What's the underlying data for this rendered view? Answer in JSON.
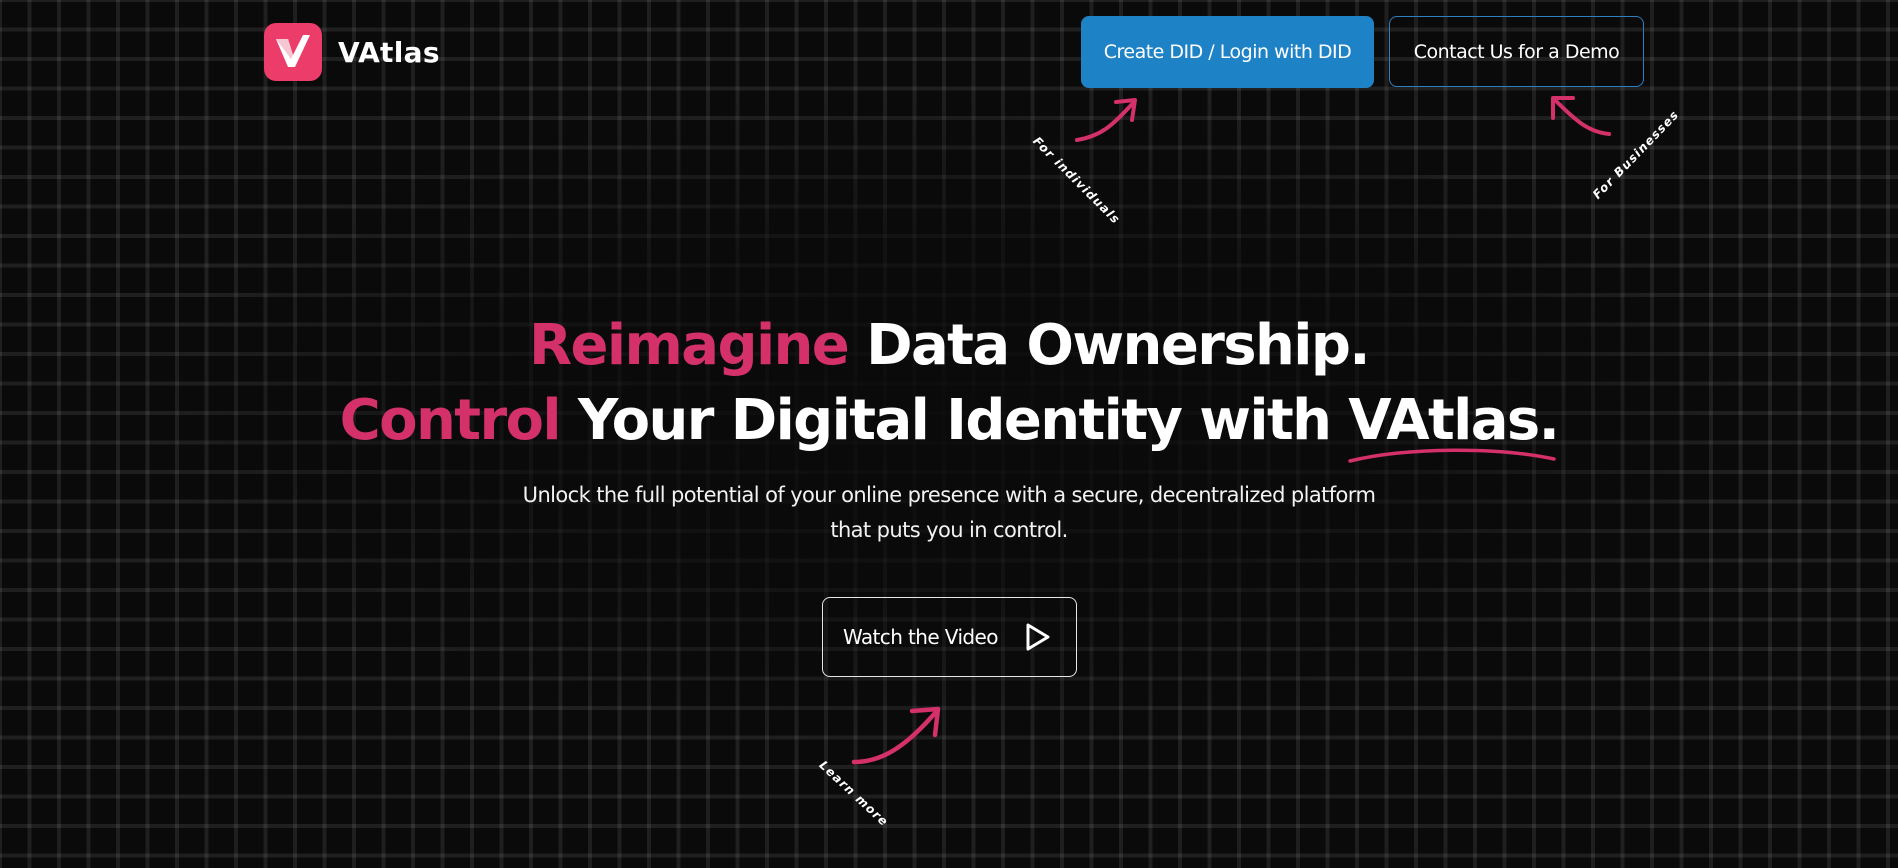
{
  "header": {
    "brand_name": "VAtlas",
    "primary_button": "Create DID / Login with DID",
    "secondary_button": "Contact Us for a Demo"
  },
  "notes": {
    "individuals": "For individuals",
    "businesses": "For Businesses",
    "learn_more": "Learn more"
  },
  "hero": {
    "line1_accent": "Reimagine",
    "line1_rest": "Data Ownership.",
    "line2_accent": "Control",
    "line2_rest": "Your Digital Identity with",
    "line2_brand": "VAtlas",
    "line2_end": ".",
    "subtitle": "Unlock the full potential of your online presence with a secure, decentralized platform that puts you in control.",
    "video_button": "Watch the Video"
  },
  "colors": {
    "accent_pink": "#d4306a",
    "logo_pink": "#ec3c6a",
    "primary_blue": "#1e82c7",
    "background": "#0a0a0a"
  },
  "icons": {
    "logo": "v-check-logo-icon",
    "play": "play-icon",
    "arrows": "hand-drawn-arrow-icon"
  }
}
